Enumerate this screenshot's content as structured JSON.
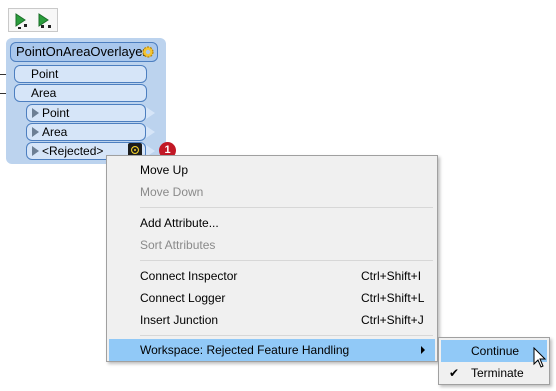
{
  "toolbar": {
    "buttons": [
      {
        "icon": "run-to-next-icon"
      },
      {
        "icon": "run-to-end-icon"
      }
    ]
  },
  "transformer": {
    "title": "PointOnAreaOverlayer",
    "input_ports": [
      "Point",
      "Area"
    ],
    "output_ports": [
      "Point",
      "Area",
      "<Rejected>"
    ],
    "rejected_badge": "1"
  },
  "context_menu": {
    "items": [
      {
        "label": "Move Up",
        "enabled": true
      },
      {
        "label": "Move Down",
        "enabled": false
      },
      {
        "label": "Add Attribute...",
        "enabled": true
      },
      {
        "label": "Sort Attributes",
        "enabled": false
      },
      {
        "label": "Connect Inspector",
        "shortcut": "Ctrl+Shift+I",
        "enabled": true
      },
      {
        "label": "Connect Logger",
        "shortcut": "Ctrl+Shift+L",
        "enabled": true
      },
      {
        "label": "Insert Junction",
        "shortcut": "Ctrl+Shift+J",
        "enabled": true
      },
      {
        "label": "Workspace: Rejected Feature Handling",
        "enabled": true,
        "highlighted": true,
        "has_submenu": true
      }
    ]
  },
  "submenu": {
    "items": [
      {
        "label": "Continue",
        "checked": false,
        "highlighted": true
      },
      {
        "label": "Terminate",
        "checked": true,
        "highlighted": false
      }
    ],
    "check_glyph": "✔"
  },
  "colors": {
    "node_bg": "#bcd3ee",
    "port_bg": "#d6e5f8",
    "highlight": "#91c9f7",
    "badge": "#c21826"
  }
}
